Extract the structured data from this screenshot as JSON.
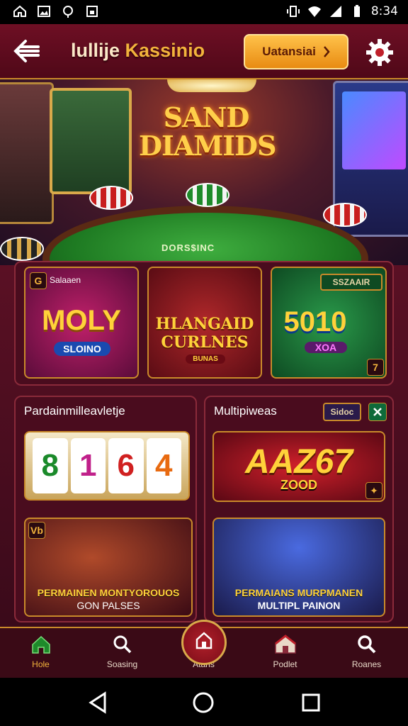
{
  "status_bar": {
    "time": "8:34",
    "left_icons": [
      "home-icon",
      "image-icon",
      "location-icon",
      "screenshot-icon"
    ],
    "right_icons": [
      "vibrate-icon",
      "wifi-icon",
      "signal-icon",
      "battery-icon"
    ]
  },
  "header": {
    "title_prefix": "lullije",
    "title_main": "Kassinio",
    "promo_label": "Uatansiai",
    "back_icon": "back-arrow-icon",
    "settings_icon": "gear-icon"
  },
  "hero": {
    "title_line1": "SAND",
    "title_line2": "DIAMIDS",
    "table_text": "DORS$INC"
  },
  "featured_games": [
    {
      "badge": "Salaaen",
      "title": "MOLY",
      "subtitle": "SLOINO"
    },
    {
      "title_line1": "HLANGAID",
      "title_line2": "CURLNES",
      "subtitle": "BUNAS"
    },
    {
      "badge": "SSZAAIR",
      "title": "5010",
      "subtitle": "XOA",
      "corner": "7"
    }
  ],
  "left_section": {
    "heading": "Pardainmilleavletje",
    "slot_digits": [
      "8",
      "1",
      "6",
      "4"
    ],
    "banner_line1": "PERMAINEN MONTYOROUOS",
    "banner_line2": "GON PALSES",
    "badge": "Vb"
  },
  "right_section": {
    "heading": "Multipiweas",
    "tag_label": "Sidoc",
    "feature_title": "AAZ67",
    "feature_subtitle": "ZOOD",
    "banner_line1": "PERMAIANS MURPMANEN",
    "banner_line2": "MULTIPL PAINON"
  },
  "bottom_nav": [
    {
      "label": "Hole",
      "icon": "home-icon",
      "active": true
    },
    {
      "label": "Soasing",
      "icon": "search-icon",
      "active": false
    },
    {
      "label": "Atans",
      "icon": "house-icon",
      "active": false
    },
    {
      "label": "Podlet",
      "icon": "house-icon",
      "active": false
    },
    {
      "label": "Roanes",
      "icon": "search-icon",
      "active": false
    }
  ],
  "colors": {
    "header_bg": "#6e0f24",
    "accent_gold": "#f2b33c",
    "button_orange": "#f5a623",
    "panel_bg": "#4a0c1e"
  }
}
